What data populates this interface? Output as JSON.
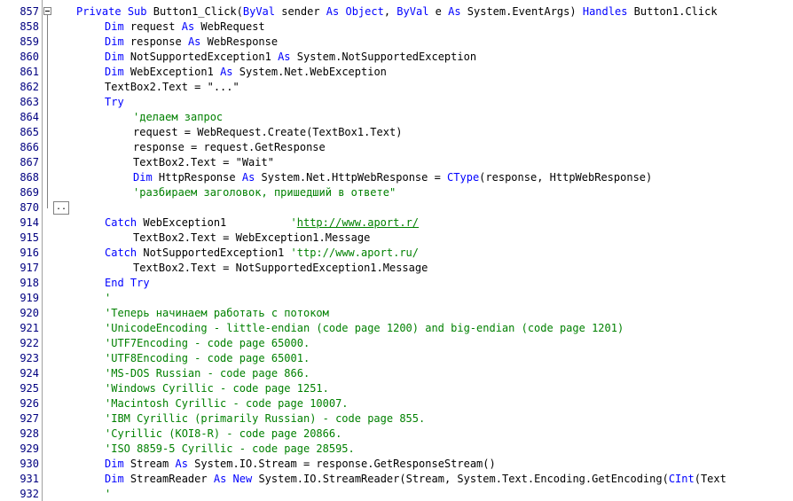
{
  "window": {
    "type": "code-editor",
    "language": "VB.NET"
  },
  "colors": {
    "keyword": "#0000ff",
    "comment": "#008000",
    "line_number": "#000080",
    "text": "#000000"
  },
  "collapsed_region_label": "..",
  "lines": [
    {
      "n": "857",
      "indent": 0,
      "fold": true,
      "tokens": [
        {
          "t": "Private",
          "k": "kw"
        },
        {
          "t": " "
        },
        {
          "t": "Sub",
          "k": "kw"
        },
        {
          "t": " Button1_Click("
        },
        {
          "t": "ByVal",
          "k": "kw"
        },
        {
          "t": " sender "
        },
        {
          "t": "As",
          "k": "kw"
        },
        {
          "t": " "
        },
        {
          "t": "Object",
          "k": "kw"
        },
        {
          "t": ", "
        },
        {
          "t": "ByVal",
          "k": "kw"
        },
        {
          "t": " e "
        },
        {
          "t": "As",
          "k": "kw"
        },
        {
          "t": " System.EventArgs) "
        },
        {
          "t": "Handles",
          "k": "kw"
        },
        {
          "t": " Button1.Click"
        }
      ]
    },
    {
      "n": "858",
      "indent": 1,
      "tokens": [
        {
          "t": "Dim",
          "k": "kw"
        },
        {
          "t": " request "
        },
        {
          "t": "As",
          "k": "kw"
        },
        {
          "t": " WebRequest"
        }
      ]
    },
    {
      "n": "859",
      "indent": 1,
      "tokens": [
        {
          "t": "Dim",
          "k": "kw"
        },
        {
          "t": " response "
        },
        {
          "t": "As",
          "k": "kw"
        },
        {
          "t": " WebResponse"
        }
      ]
    },
    {
      "n": "860",
      "indent": 1,
      "tokens": [
        {
          "t": "Dim",
          "k": "kw"
        },
        {
          "t": " NotSupportedException1 "
        },
        {
          "t": "As",
          "k": "kw"
        },
        {
          "t": " System.NotSupportedException"
        }
      ]
    },
    {
      "n": "861",
      "indent": 1,
      "tokens": [
        {
          "t": "Dim",
          "k": "kw"
        },
        {
          "t": " WebException1 "
        },
        {
          "t": "As",
          "k": "kw"
        },
        {
          "t": " System.Net.WebException"
        }
      ]
    },
    {
      "n": "862",
      "indent": 1,
      "tokens": [
        {
          "t": "TextBox2.Text = \"...\""
        }
      ]
    },
    {
      "n": "863",
      "indent": 1,
      "tokens": [
        {
          "t": "Try",
          "k": "kw"
        }
      ]
    },
    {
      "n": "864",
      "indent": 2,
      "tokens": [
        {
          "t": "'делаем запрос",
          "k": "cm"
        }
      ]
    },
    {
      "n": "865",
      "indent": 2,
      "tokens": [
        {
          "t": "request = WebRequest.Create(TextBox1.Text)"
        }
      ]
    },
    {
      "n": "866",
      "indent": 2,
      "tokens": [
        {
          "t": "response = request.GetResponse"
        }
      ]
    },
    {
      "n": "867",
      "indent": 2,
      "tokens": [
        {
          "t": "TextBox2.Text = \"Wait\""
        }
      ]
    },
    {
      "n": "868",
      "indent": 2,
      "tokens": [
        {
          "t": "Dim",
          "k": "kw"
        },
        {
          "t": " HttpResponse "
        },
        {
          "t": "As",
          "k": "kw"
        },
        {
          "t": " System.Net.HttpWebResponse = "
        },
        {
          "t": "CType",
          "k": "kw"
        },
        {
          "t": "(response, HttpWebResponse)"
        }
      ]
    },
    {
      "n": "869",
      "indent": 2,
      "tokens": [
        {
          "t": "'разбираем заголовок, пришедший в ответе\"",
          "k": "cm"
        }
      ]
    },
    {
      "n": "870",
      "indent": 0,
      "collapsed": true,
      "tokens": []
    },
    {
      "n": "914",
      "indent": 1,
      "tokens": [
        {
          "t": "Catch",
          "k": "kw"
        },
        {
          "t": " WebException1          "
        },
        {
          "t": "'",
          "k": "cm"
        },
        {
          "t": "http://www.aport.r/",
          "k": "cm url"
        }
      ]
    },
    {
      "n": "915",
      "indent": 2,
      "tokens": [
        {
          "t": "TextBox2.Text = WebException1.Message"
        }
      ]
    },
    {
      "n": "916",
      "indent": 1,
      "tokens": [
        {
          "t": "Catch",
          "k": "kw"
        },
        {
          "t": " NotSupportedException1 "
        },
        {
          "t": "'ttp://www.aport.ru/",
          "k": "cm"
        }
      ]
    },
    {
      "n": "917",
      "indent": 2,
      "tokens": [
        {
          "t": "TextBox2.Text = NotSupportedException1.Message"
        }
      ]
    },
    {
      "n": "918",
      "indent": 1,
      "tokens": [
        {
          "t": "End",
          "k": "kw"
        },
        {
          "t": " "
        },
        {
          "t": "Try",
          "k": "kw"
        }
      ]
    },
    {
      "n": "919",
      "indent": 1,
      "tokens": [
        {
          "t": "'",
          "k": "cm"
        }
      ]
    },
    {
      "n": "920",
      "indent": 1,
      "tokens": [
        {
          "t": "'Теперь начинаем работать с потоком",
          "k": "cm"
        }
      ]
    },
    {
      "n": "921",
      "indent": 1,
      "tokens": [
        {
          "t": "'UnicodeEncoding - little-endian (code page 1200) and big-endian (code page 1201)",
          "k": "cm"
        }
      ]
    },
    {
      "n": "922",
      "indent": 1,
      "tokens": [
        {
          "t": "'UTF7Encoding - code page 65000.",
          "k": "cm"
        }
      ]
    },
    {
      "n": "923",
      "indent": 1,
      "tokens": [
        {
          "t": "'UTF8Encoding - code page 65001.",
          "k": "cm"
        }
      ]
    },
    {
      "n": "924",
      "indent": 1,
      "tokens": [
        {
          "t": "'MS-DOS Russian - code page 866.",
          "k": "cm"
        }
      ]
    },
    {
      "n": "925",
      "indent": 1,
      "tokens": [
        {
          "t": "'Windows Cyrillic - code page 1251.",
          "k": "cm"
        }
      ]
    },
    {
      "n": "926",
      "indent": 1,
      "tokens": [
        {
          "t": "'Macintosh Cyrillic - code page 10007.",
          "k": "cm"
        }
      ]
    },
    {
      "n": "927",
      "indent": 1,
      "tokens": [
        {
          "t": "'IBM Cyrillic (primarily Russian) - code page 855.",
          "k": "cm"
        }
      ]
    },
    {
      "n": "928",
      "indent": 1,
      "tokens": [
        {
          "t": "'Cyrillic (KOI8-R) - code page 20866.",
          "k": "cm"
        }
      ]
    },
    {
      "n": "929",
      "indent": 1,
      "tokens": [
        {
          "t": "'ISO 8859-5 Cyrillic - code page 28595.",
          "k": "cm"
        }
      ]
    },
    {
      "n": "930",
      "indent": 1,
      "tokens": [
        {
          "t": "Dim",
          "k": "kw"
        },
        {
          "t": " Stream "
        },
        {
          "t": "As",
          "k": "kw"
        },
        {
          "t": " System.IO.Stream = response.GetResponseStream()"
        }
      ]
    },
    {
      "n": "931",
      "indent": 1,
      "tokens": [
        {
          "t": "Dim",
          "k": "kw"
        },
        {
          "t": " StreamReader "
        },
        {
          "t": "As",
          "k": "kw"
        },
        {
          "t": " "
        },
        {
          "t": "New",
          "k": "kw"
        },
        {
          "t": " System.IO.StreamReader(Stream, System.Text.Encoding.GetEncoding("
        },
        {
          "t": "CInt",
          "k": "kw"
        },
        {
          "t": "(Text"
        }
      ]
    },
    {
      "n": "932",
      "indent": 1,
      "tokens": [
        {
          "t": "'",
          "k": "cm"
        }
      ]
    }
  ]
}
